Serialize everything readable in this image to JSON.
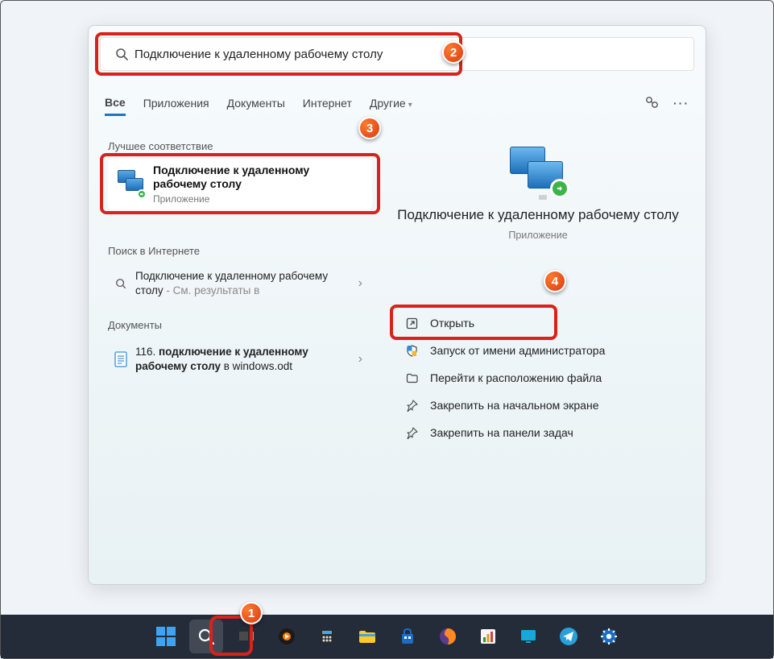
{
  "search": {
    "value": "Подключение к удаленному рабочему столу"
  },
  "tabs": {
    "all": "Все",
    "apps": "Приложения",
    "docs": "Документы",
    "web": "Интернет",
    "more": "Другие"
  },
  "section": {
    "best": "Лучшее соответствие",
    "web": "Поиск в Интернете",
    "docs": "Документы"
  },
  "result": {
    "title": "Подключение к удаленному рабочему столу",
    "sub": "Приложение"
  },
  "webresult": {
    "main": "Подключение к удаленному рабочему столу",
    "suffix": " - См. результаты в"
  },
  "docresult": {
    "prefix": "116. ",
    "bold": "подключение к удаленному рабочему столу",
    "suffix": " в windows.odt"
  },
  "preview": {
    "title": "Подключение к удаленному рабочему столу",
    "sub": "Приложение"
  },
  "actions": {
    "open": "Открыть",
    "admin": "Запуск от имени администратора",
    "location": "Перейти к расположению файла",
    "pinstart": "Закрепить на начальном экране",
    "pintask": "Закрепить на панели задач"
  },
  "badges": {
    "b1": "1",
    "b2": "2",
    "b3": "3",
    "b4": "4"
  }
}
